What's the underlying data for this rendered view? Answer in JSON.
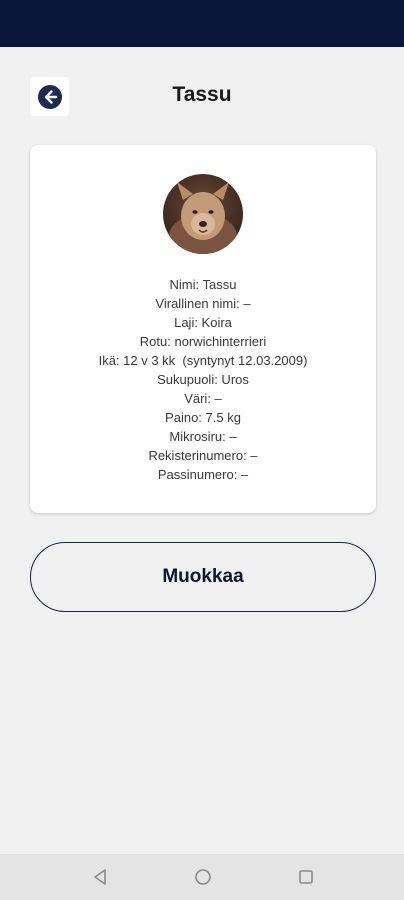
{
  "header": {
    "title": "Tassu"
  },
  "profile": {
    "lines": [
      "Nimi: Tassu",
      "Virallinen nimi: –",
      "Laji: Koira",
      "Rotu: norwichinterrieri",
      "Ikä: 12 v 3 kk  (syntynyt 12.03.2009)",
      "Sukupuoli: Uros",
      "Väri: –",
      "Paino: 7.5 kg",
      "Mikrosiru: –",
      "Rekisterinumero: –",
      "Passinumero: –"
    ]
  },
  "actions": {
    "edit_label": "Muokkaa"
  },
  "colors": {
    "status_bar": "#0a163a",
    "accent": "#1a2240",
    "background": "#f1f1f1"
  },
  "icons": {
    "back": "arrow-left-circle-icon",
    "avatar": "dog-photo",
    "nav_back": "triangle-back-icon",
    "nav_home": "circle-home-icon",
    "nav_recent": "square-recents-icon"
  }
}
